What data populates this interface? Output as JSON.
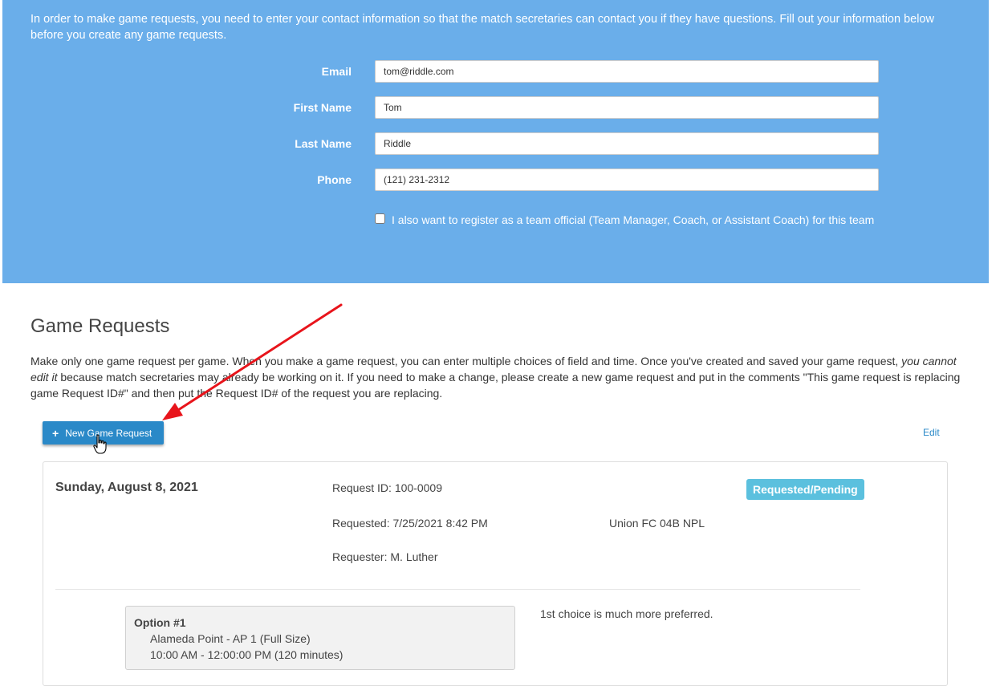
{
  "contact": {
    "intro": "In order to make game requests, you need to enter your contact information so that the match secretaries can contact you if they have questions. Fill out your information below before you create any game requests.",
    "fields": [
      {
        "label": "Email",
        "value": "tom@riddle.com"
      },
      {
        "label": "First Name",
        "value": "Tom"
      },
      {
        "label": "Last Name",
        "value": "Riddle"
      },
      {
        "label": "Phone",
        "value": "(121) 231-2312"
      }
    ],
    "team_official_checkbox": {
      "label": "I also want to register as a team official (Team Manager, Coach, or Assistant Coach) for this team",
      "checked": false
    }
  },
  "game_requests": {
    "title": "Game Requests",
    "desc_part1": "Make only one game request per game. When you make a game request, you can enter multiple choices of field and time. Once you've created and saved your game request, ",
    "desc_emphasis": "you cannot edit it",
    "desc_part2": " because match secretaries may already be working on it. If you need to make a change, please create a new game request and put in the comments \"This game request is replacing game Request ID#\" and then put the Request ID# of the request you are replacing.",
    "new_button_label": "New Game Request",
    "edit_label": "Edit",
    "request": {
      "date": "Sunday, August 8, 2021",
      "request_id": "Request ID: 100-0009",
      "requested": "Requested: 7/25/2021 8:42 PM",
      "requester": "Requester: M. Luther",
      "team": "Union FC 04B NPL",
      "status": "Requested/Pending",
      "option": {
        "title": "Option #1",
        "field": "Alameda Point - AP 1 (Full Size)",
        "time": "10:00 AM - 12:00:00 PM (120 minutes)"
      },
      "comment": "1st choice is much more preferred."
    }
  },
  "colors": {
    "panel_bg": "#6aaeea",
    "button_bg": "#2a89c8",
    "badge_bg": "#5bc0de",
    "annotation_arrow": "#e8141b"
  },
  "icons": {
    "plus": "plus-icon",
    "cursor": "hand-pointer-icon",
    "arrow": "annotation-arrow-icon"
  }
}
